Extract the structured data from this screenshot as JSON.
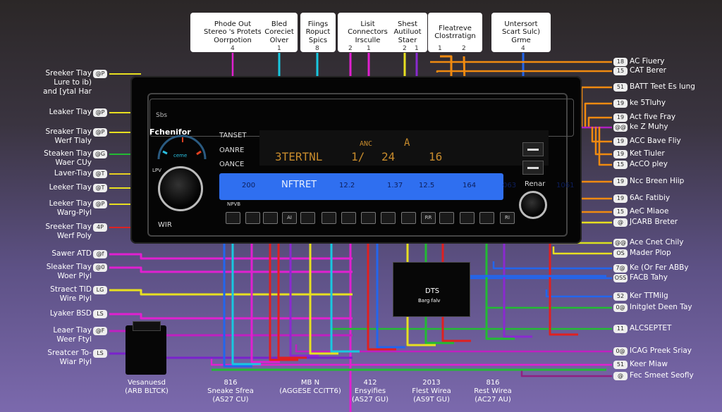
{
  "top_boxes": [
    {
      "lines": [
        "Phode Out",
        "Stereo 's Protets",
        "Oorrpotion"
      ],
      "pins": [
        "4"
      ]
    },
    {
      "lines": [
        "Bled",
        "Coreciet",
        "Olver"
      ],
      "pins": [
        "1"
      ]
    },
    {
      "lines": [
        "Fiings",
        "Ropuct",
        "Spics"
      ],
      "pins": [
        "8"
      ]
    },
    {
      "lines": [
        "Lisit",
        "Connectors",
        "Irsculle"
      ],
      "pins": [
        "2",
        "1"
      ]
    },
    {
      "lines": [
        "Shest",
        "Autiluot",
        "Staer"
      ],
      "pins": [
        "2",
        "1"
      ]
    },
    {
      "lines": [
        "Fleatreve",
        "Clostrratign"
      ],
      "pins": [
        "1",
        "2"
      ]
    },
    {
      "lines": [
        "Untersort",
        "Scart Sulc)",
        "Grme"
      ],
      "pins": [
        "4"
      ]
    }
  ],
  "stereo": {
    "brand": "Fchenifor",
    "slot_label": "Sbs",
    "menu": [
      "TANSET",
      "OANRE",
      "OANCE"
    ],
    "gauge_label": "ceme",
    "left_small": "LPV",
    "bottom_left": "WIR",
    "display_top": [
      "ANC",
      "A"
    ],
    "display_main": [
      "3TERTNL",
      "1/",
      "24",
      "16"
    ],
    "blue_strip": [
      "200",
      "NFTRET",
      "12.2",
      "1.37",
      "12.5",
      "164",
      "063",
      "1061"
    ],
    "under_strip": "NPVB",
    "buttons": [
      "",
      "",
      "",
      "AI",
      "",
      "",
      "",
      "",
      "",
      "",
      "RR",
      "",
      "",
      "",
      "RI",
      ""
    ],
    "right_knob_label": "Renar"
  },
  "module": {
    "logo": "DTS",
    "caption": "Barg falv"
  },
  "left_labels": [
    {
      "lines": [
        "Sreeker Tlay",
        "Lure to ib)",
        "and [ytal Har"
      ],
      "badge": "@P",
      "wire": "#e8e020"
    },
    {
      "lines": [
        "Leaker Tlay"
      ],
      "badge": "@P",
      "wire": "#e8e020"
    },
    {
      "lines": [
        "Sreaker Tlay",
        "Werf Tlaly"
      ],
      "badge": "@P",
      "wire": "#e8e020"
    },
    {
      "lines": [
        "Steaken Tlay",
        "Waer CUy"
      ],
      "badge": "@G",
      "wire": "#22bb33"
    },
    {
      "lines": [
        "Laver-Tiay"
      ],
      "badge": "@T",
      "wire": "#e8d020"
    },
    {
      "lines": [
        "Leeker Tlay"
      ],
      "badge": "@T",
      "wire": "#e8e020"
    },
    {
      "lines": [
        "Leeker Tlay",
        "Warg-Plyl"
      ],
      "badge": "@P",
      "wire": "#e8e020"
    },
    {
      "lines": [
        "Sreeker Tlay",
        "Werf Poly"
      ],
      "badge": "4P",
      "wire": "#dd2222"
    },
    {
      "lines": [
        "Sawer ATD"
      ],
      "badge": "@f",
      "wire": "#e020d0"
    },
    {
      "lines": [
        "Sleaker Tlay",
        "Woer Plyl"
      ],
      "badge": "@0",
      "wire": "#e020d0"
    },
    {
      "lines": [
        "Straect TID",
        "Wire Plyl"
      ],
      "badge": "LG",
      "wire": "#e8e020"
    },
    {
      "lines": [
        "Lyaker BSD"
      ],
      "badge": "LS",
      "wire": "#e020d0"
    },
    {
      "lines": [
        "Leaer Tlay",
        "Weer Ftyl"
      ],
      "badge": "@F",
      "wire": "#c020c0"
    },
    {
      "lines": [
        "Sreatcer To-",
        "Wiar Plyl"
      ],
      "badge": "LS",
      "wire": "#7a22cc"
    }
  ],
  "right_labels": [
    {
      "badge": "18",
      "text": "AC Fiuery",
      "wire": "#f08a10"
    },
    {
      "badge": "15",
      "text": "CAT Berer",
      "wire": "#f08a10"
    },
    {
      "badge": "51",
      "text": "BATT Teet Es lung",
      "wire": "#f08a10"
    },
    {
      "badge": "19",
      "text": "ke 5Tluhy",
      "wire": "#f08a10"
    },
    {
      "badge": "19",
      "text": "Act five Fray",
      "wire": "#f08a10"
    },
    {
      "badge": "@@",
      "text": "ke Z Muhy",
      "wire": "#b020c0"
    },
    {
      "badge": "19",
      "text": "ACC Bave Fliy",
      "wire": "#f08a10"
    },
    {
      "badge": "19",
      "text": "Ket Tiuler",
      "wire": "#f08a10"
    },
    {
      "badge": "15",
      "text": "AcCO pley",
      "wire": "#f08a10"
    },
    {
      "badge": "19",
      "text": "Ncc Breen Hiip",
      "wire": "#f08a10"
    },
    {
      "badge": "19",
      "text": "6Ac Fatibiy",
      "wire": "#f08a10"
    },
    {
      "badge": "15",
      "text": "AeC Miaoe",
      "wire": "#f08a10"
    },
    {
      "badge": "@",
      "text": "JCARB Breter",
      "wire": "#e8e020"
    },
    {
      "badge": "@@",
      "text": "Ace Cnet Chily",
      "wire": "#d8e020"
    },
    {
      "badge": "OS",
      "text": "Mader Plop",
      "wire": "#e8e020"
    },
    {
      "badge": "7@",
      "text": "Ke (Or Fer ABBy",
      "wire": "#2266ee"
    },
    {
      "badge": "OSS",
      "text": "FACB Tahy",
      "wire": "#2266ee"
    },
    {
      "badge": "52",
      "text": "Ker TTMilg",
      "wire": "#2266ee"
    },
    {
      "badge": "0@",
      "text": "Initglet Deen Tay",
      "wire": "#22bb33"
    },
    {
      "badge": "11",
      "text": "ALCSEPTET",
      "wire": "#22bb33"
    },
    {
      "badge": "0@",
      "text": "ICAG Preek Sriay",
      "wire": "#c020c0"
    },
    {
      "badge": "51",
      "text": "Keer Miaw",
      "wire": "#e020d0"
    },
    {
      "badge": "@",
      "text": "Fec Smeet Seofly",
      "wire": "#902080"
    }
  ],
  "bottom_labels": [
    {
      "lines": [
        "Vesanuesd",
        "(ARB BLTCK)"
      ]
    },
    {
      "lines": [
        "816",
        "Sneake Sfrea",
        "(AS27 CU)"
      ]
    },
    {
      "lines": [
        "MB N",
        "(AGGESE CCITT6)"
      ]
    },
    {
      "lines": [
        "412",
        "Ensyifies",
        "(AS27 GU)"
      ]
    },
    {
      "lines": [
        "2013",
        "Flest Wirea",
        "(AS9T GU)"
      ]
    },
    {
      "lines": [
        "816",
        "Rest Wirea",
        "(AC27 AU)"
      ]
    }
  ],
  "colors": {
    "orange": "#f08a10",
    "yellow": "#e8e020",
    "green": "#22bb33",
    "cyan": "#18c8e0",
    "magenta": "#e020d0",
    "red": "#e02020",
    "blue": "#2266ee",
    "purple": "#8a2ad0",
    "display_blue": "#2f6ff0"
  }
}
